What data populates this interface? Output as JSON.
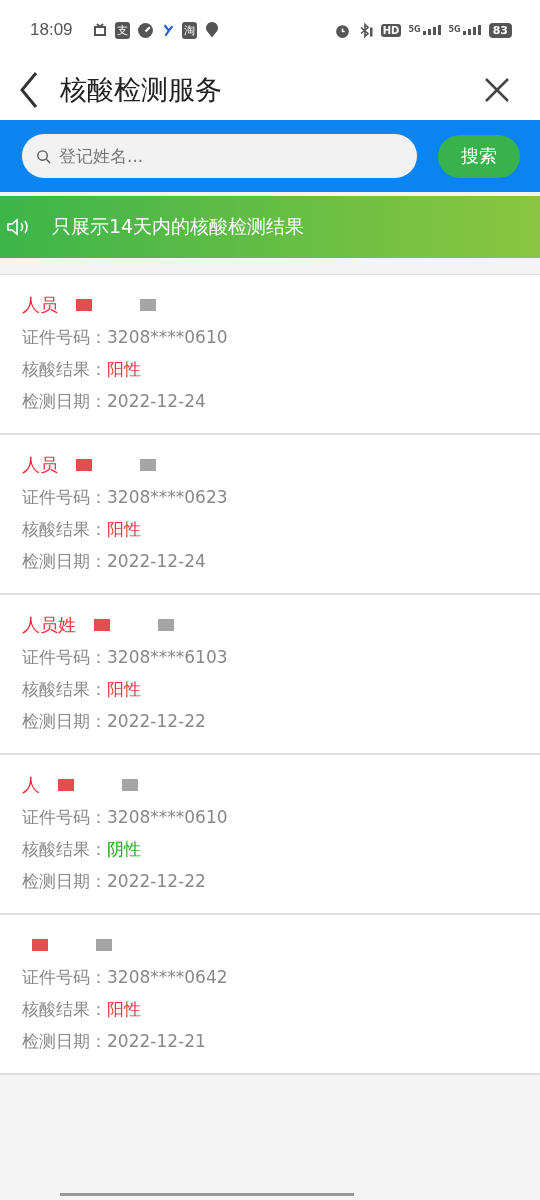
{
  "status_bar": {
    "time": "18:09",
    "app_badges": [
      "支",
      "淘"
    ],
    "hd": "HD",
    "networks": [
      "5G",
      "5G"
    ],
    "battery": "83"
  },
  "header": {
    "title": "核酸检测服务"
  },
  "search": {
    "placeholder": "登记姓名...",
    "button": "搜索"
  },
  "notice": {
    "text": "只展示14天内的核酸检测结果"
  },
  "records": [
    {
      "name": "人员",
      "id_label": "证件号码：",
      "id": "3208****0610",
      "result_label": "核酸结果：",
      "result": "阳性",
      "color": "#e8333a",
      "date_label": "检测日期：",
      "date": "2022-12-24"
    },
    {
      "name": "人员",
      "id_label": "证件号码：",
      "id": "3208****0623",
      "result_label": "核酸结果：",
      "result": "阳性",
      "color": "#e8333a",
      "date_label": "检测日期：",
      "date": "2022-12-24"
    },
    {
      "name": "人员姓",
      "id_label": "证件号码：",
      "id": "3208****6103",
      "result_label": "核酸结果：",
      "result": "阳性",
      "color": "#e8333a",
      "date_label": "检测日期：",
      "date": "2022-12-22"
    },
    {
      "name": "人",
      "id_label": "证件号码：",
      "id": "3208****0610",
      "result_label": "核酸结果：",
      "result": "阴性",
      "color": "#1aad19",
      "date_label": "检测日期：",
      "date": "2022-12-22"
    },
    {
      "id_label": "证件号码：",
      "id": "3208****0642",
      "result_label": "核酸结果：",
      "result": "阳性",
      "color": "#e8333a",
      "date_label": "检测日期：",
      "date": "2022-12-21"
    }
  ]
}
